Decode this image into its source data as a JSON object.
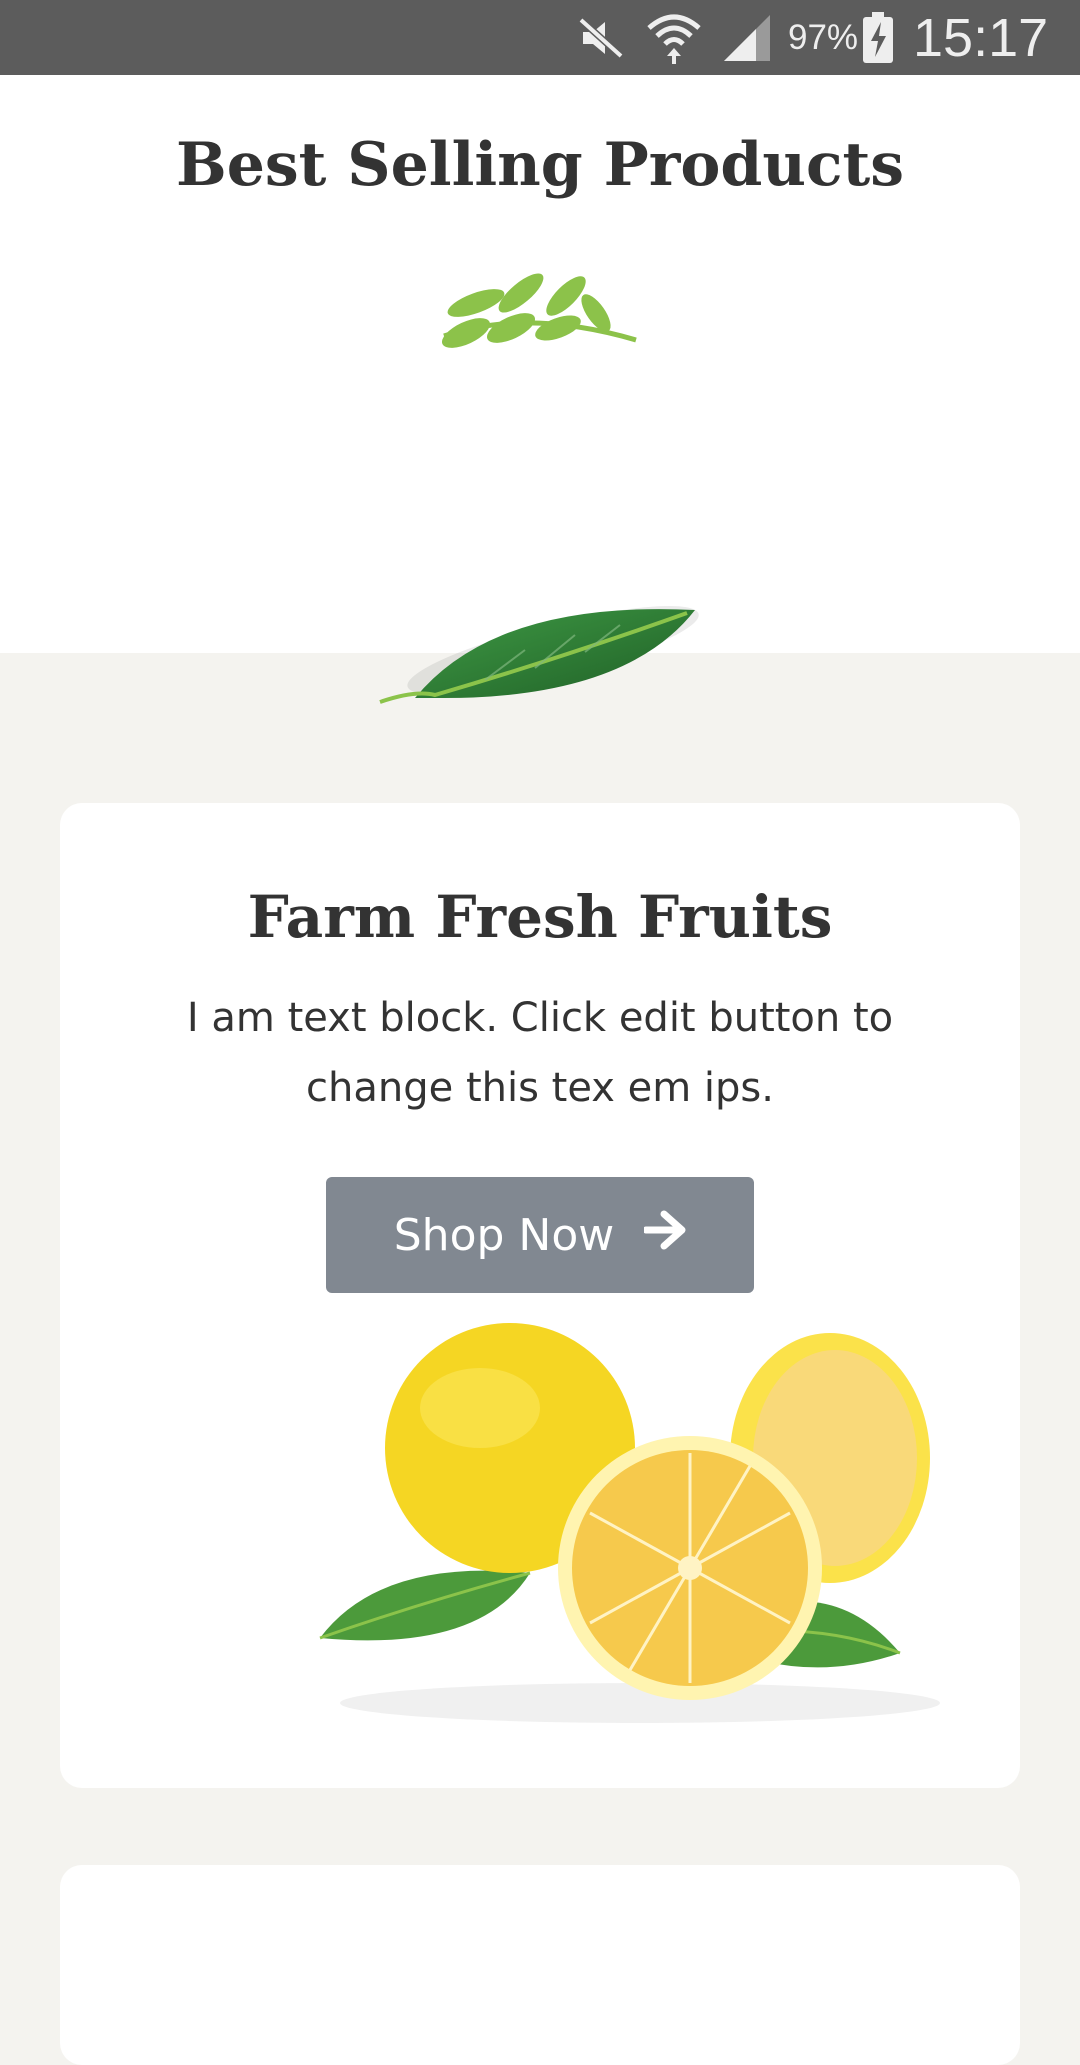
{
  "status_bar": {
    "battery_percent": "97%",
    "time": "15:17",
    "icons": [
      "mute-icon",
      "wifi-icon",
      "signal-icon",
      "battery-charging-icon"
    ]
  },
  "section": {
    "title": "Best Selling Products"
  },
  "card": {
    "title": "Farm Fresh Fruits",
    "text": "I am text block. Click edit button to change this tex em ips.",
    "button_label": "Shop Now",
    "button_icon": "arrow-right-icon"
  },
  "colors": {
    "status_bar_bg": "#5c5c5c",
    "page_bg": "#f4f3ef",
    "card_bg": "#ffffff",
    "button_bg": "#818891",
    "heading": "#333333",
    "sprig_green": "#8cc24a",
    "leaf_green": "#2f7d36",
    "lemon_yellow": "#f7dc2a"
  }
}
